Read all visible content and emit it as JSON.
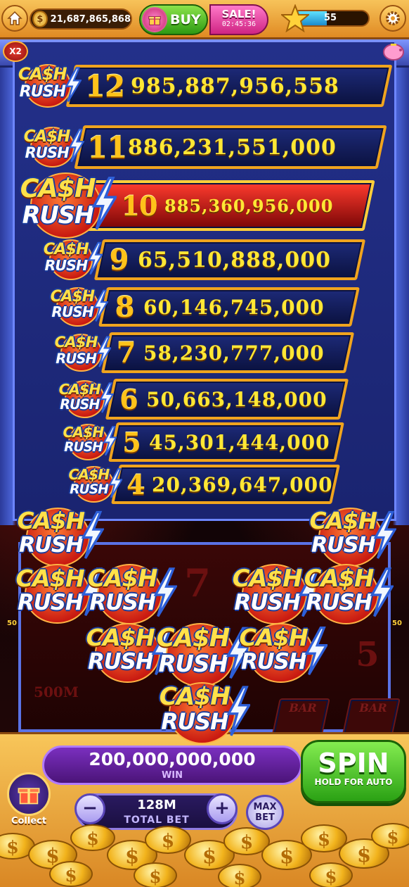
{
  "topbar": {
    "coins": "21,687,865,868",
    "buy_label": "BUY",
    "sale_label": "SALE!",
    "sale_timer": "02:45:36",
    "level": "55",
    "level_progress": 0.45
  },
  "multiplier_badge": "X2",
  "logo": {
    "word1": "CA$H",
    "word2": "RUSH"
  },
  "jackpots": [
    {
      "count": "12",
      "amount": "985,887,956,558",
      "highlight": false
    },
    {
      "count": "11",
      "amount": "886,231,551,000",
      "highlight": false
    },
    {
      "count": "10",
      "amount": "885,360,956,000",
      "highlight": true
    },
    {
      "count": "9",
      "amount": "65,510,888,000",
      "highlight": false
    },
    {
      "count": "8",
      "amount": "60,146,745,000",
      "highlight": false
    },
    {
      "count": "7",
      "amount": "58,230,777,000",
      "highlight": false
    },
    {
      "count": "6",
      "amount": "50,663,148,000",
      "highlight": false
    },
    {
      "count": "5",
      "amount": "45,301,444,000",
      "highlight": false
    },
    {
      "count": "4",
      "amount": "20,369,647,000",
      "highlight": false
    }
  ],
  "reels": {
    "symbol_seven": "7",
    "symbol_five": "5",
    "bar_label": "BAR",
    "reel_logo_value": "500M",
    "side_marker": "50"
  },
  "win": {
    "amount": "200,000,000,000",
    "label": "WIN"
  },
  "spin": {
    "label": "SPIN",
    "sub": "HOLD FOR AUTO"
  },
  "bet": {
    "value": "128M",
    "label": "TOTAL BET",
    "minus": "−",
    "plus": "+",
    "max_label": "MAX BET"
  },
  "collect_label": "Collect",
  "colors": {
    "accent_gold": "#f0a41e",
    "panel_blue": "#23308a",
    "spin_green": "#2aa114",
    "win_purple": "#7a2fbf"
  }
}
